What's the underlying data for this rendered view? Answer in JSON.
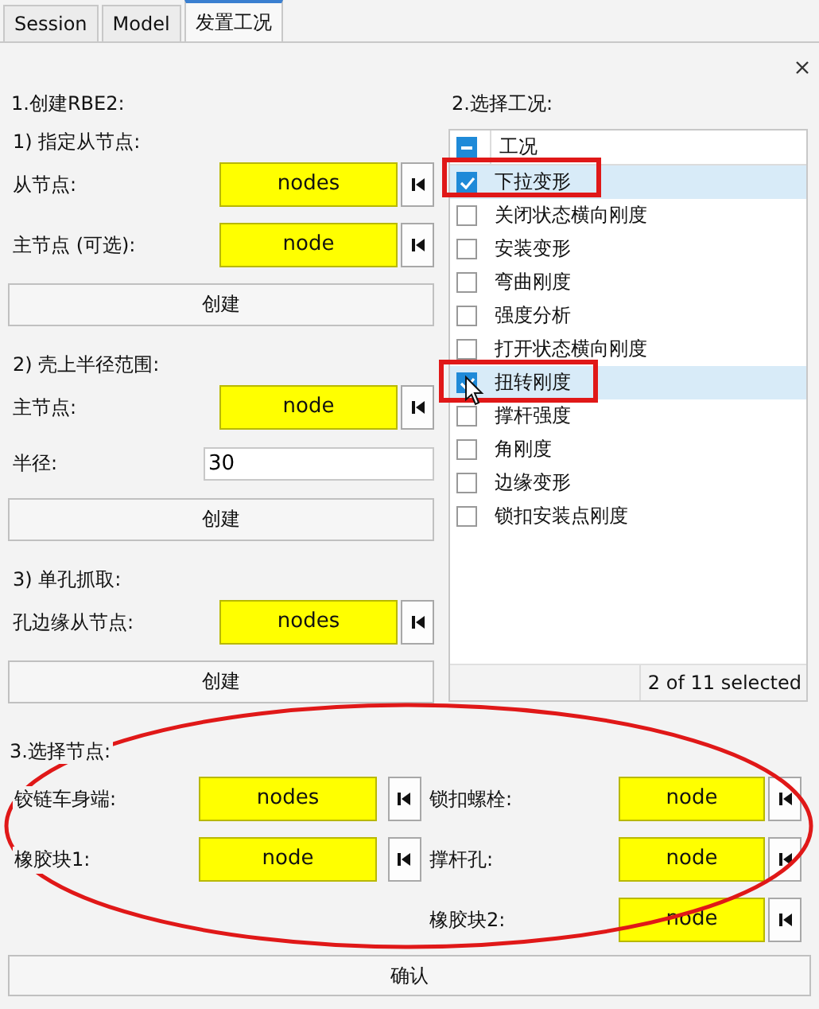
{
  "tabs": [
    {
      "label": "Session",
      "selected": false
    },
    {
      "label": "Model",
      "selected": false
    },
    {
      "label": "发置工况",
      "selected": true
    }
  ],
  "rbe2": {
    "title": "1.创建RBE2:",
    "groups": [
      {
        "title": "1) 指定从节点:",
        "rows": [
          {
            "kind": "picker",
            "label": "从节点:",
            "value": "nodes"
          },
          {
            "kind": "picker",
            "label": "主节点 (可选):",
            "value": "node"
          }
        ],
        "button": "创建"
      },
      {
        "title": "2) 壳上半径范围:",
        "rows": [
          {
            "kind": "picker",
            "label": "主节点:",
            "value": "node"
          },
          {
            "kind": "input",
            "label": "半径:",
            "value": "30"
          }
        ],
        "button": "创建"
      },
      {
        "title": "3) 单孔抓取:",
        "rows": [
          {
            "kind": "picker",
            "label": "孔边缘从节点:",
            "value": "nodes"
          }
        ],
        "button": "创建"
      }
    ]
  },
  "load_cases": {
    "title": "2.选择工况:",
    "header": "工况",
    "header_partial": true,
    "items": [
      {
        "label": "下拉变形",
        "checked": true,
        "selected": true
      },
      {
        "label": "关闭状态横向刚度",
        "checked": false,
        "selected": false
      },
      {
        "label": "安装变形",
        "checked": false,
        "selected": false
      },
      {
        "label": "弯曲刚度",
        "checked": false,
        "selected": false
      },
      {
        "label": "强度分析",
        "checked": false,
        "selected": false
      },
      {
        "label": "打开状态横向刚度",
        "checked": false,
        "selected": false
      },
      {
        "label": "扭转刚度",
        "checked": true,
        "selected": true
      },
      {
        "label": "撑杆强度",
        "checked": false,
        "selected": false
      },
      {
        "label": "角刚度",
        "checked": false,
        "selected": false
      },
      {
        "label": "边缘变形",
        "checked": false,
        "selected": false
      },
      {
        "label": "锁扣安装点刚度",
        "checked": false,
        "selected": false
      }
    ],
    "footer": "2 of 11 selected"
  },
  "node_select": {
    "title": "3.选择节点:",
    "left": [
      {
        "label": "铰链车身端:",
        "value": "nodes"
      },
      {
        "label": "橡胶块1:",
        "value": "node"
      }
    ],
    "right": [
      {
        "label": "锁扣螺栓:",
        "value": "node"
      },
      {
        "label": "撑杆孔:",
        "value": "node"
      },
      {
        "label": "橡胶块2:",
        "value": "node"
      }
    ]
  },
  "confirm": "确认"
}
